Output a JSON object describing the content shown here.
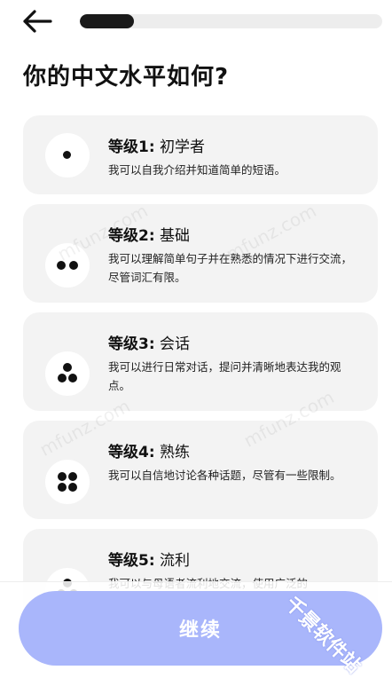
{
  "header": {
    "back_icon": "arrow-left-icon",
    "progress_fraction": 0.18
  },
  "page": {
    "title": "你的中文水平如何?"
  },
  "levels": [
    {
      "prefix": "等级1:",
      "name": "初学者",
      "description": "我可以自我介绍并知道简单的短语。",
      "icon": "one-dot-icon"
    },
    {
      "prefix": "等级2:",
      "name": "基础",
      "description": "我可以理解简单句子并在熟悉的情况下进行交流，尽管词汇有限。",
      "icon": "two-dots-icon"
    },
    {
      "prefix": "等级3:",
      "name": "会话",
      "description": "我可以进行日常对话，提问并清晰地表达我的观点。",
      "icon": "three-dots-icon"
    },
    {
      "prefix": "等级4:",
      "name": "熟练",
      "description": "我可以自信地讨论各种话题，尽管有一些限制。",
      "icon": "four-dots-icon"
    },
    {
      "prefix": "等级5:",
      "name": "流利",
      "description": "我可以与母语者流利地交流，使用广泛的",
      "icon": "five-dots-icon"
    }
  ],
  "footer": {
    "continue_label": "继续"
  },
  "watermarks": {
    "text": "mfunz.com",
    "brand": "千景软件站"
  },
  "colors": {
    "accent": "#a9b6fb",
    "card_bg": "#f3f3f3",
    "progress_fill": "#1a1a1a"
  }
}
